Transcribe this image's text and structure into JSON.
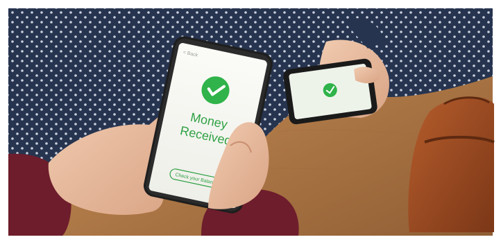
{
  "phone_main": {
    "back_label": "< Back",
    "headline_line1": "Money",
    "headline_line2": "Received",
    "balance_button": "Check your Balance"
  },
  "colors": {
    "accent_green": "#2fb34a",
    "table_wood": "#b07a48",
    "shirt_navy": "#27344f",
    "sleeve_maroon": "#6e1d2c",
    "bag_leather": "#9a4a22"
  },
  "icons": {
    "main_check": "checkmark-circle-icon",
    "secondary_check": "checkmark-circle-icon"
  }
}
